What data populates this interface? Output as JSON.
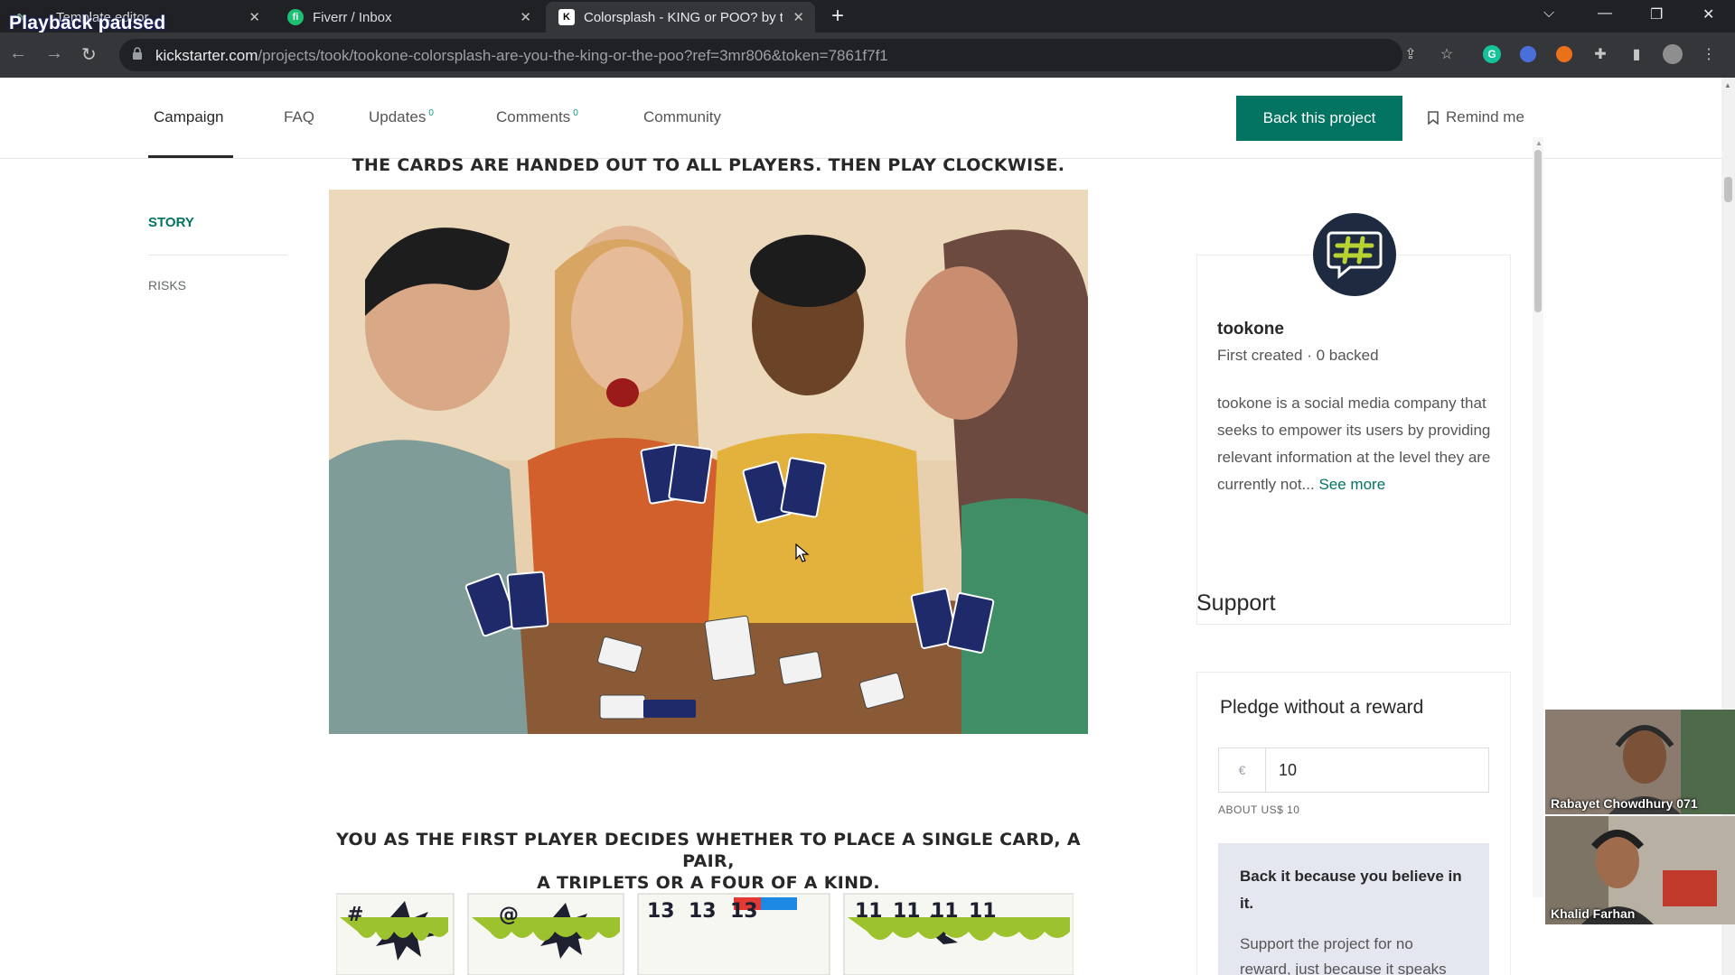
{
  "overlay": {
    "playback_text": "Playback paused"
  },
  "browser": {
    "tabs": [
      {
        "title": "Template editor",
        "active": false
      },
      {
        "title": "Fiverr / Inbox",
        "active": false
      },
      {
        "title": "Colorsplash - KING or POO? by t",
        "active": true
      }
    ],
    "url_host": "kickstarter.com",
    "url_path": "/projects/took/tookone-colorsplash-are-you-the-king-or-the-poo?ref=3mr806&token=7861f7f1"
  },
  "project_nav": {
    "tabs": [
      {
        "label": "Campaign",
        "badge": ""
      },
      {
        "label": "FAQ",
        "badge": ""
      },
      {
        "label": "Updates",
        "badge": "0"
      },
      {
        "label": "Comments",
        "badge": "0"
      },
      {
        "label": "Community",
        "badge": ""
      }
    ],
    "back_button": "Back this project",
    "remind": "Remind me"
  },
  "sidebar": {
    "items": [
      "STORY",
      "RISKS"
    ]
  },
  "story": {
    "heading_top": "THE CARDS ARE HANDED OUT TO ALL PLAYERS. THEN PLAY CLOCKWISE.",
    "heading_mid_line1": "YOU AS THE FIRST PLAYER DECIDES WHETHER TO PLACE A SINGLE CARD, A PAIR,",
    "heading_mid_line2": "A TRIPLETS OR A FOUR OF A KIND."
  },
  "creator": {
    "name": "tookone",
    "meta": "First created · 0 backed",
    "bio": "tookone is a social media company that seeks to empower its users by providing relevant information at the level they are currently not...",
    "see_more": "See more"
  },
  "support": {
    "heading": "Support",
    "pledge_title": "Pledge without a reward",
    "currency": "€",
    "amount": "10",
    "about": "ABOUT US$ 10",
    "believe_title": "Back it because you believe in it.",
    "believe_text": "Support the project for no reward, just because it speaks"
  },
  "video_call": {
    "participants": [
      "Rabayet Chowdhury 071",
      "Khalid Farhan"
    ]
  },
  "colors": {
    "kickstarter_green": "#037362",
    "accent_teal": "#009e74"
  }
}
